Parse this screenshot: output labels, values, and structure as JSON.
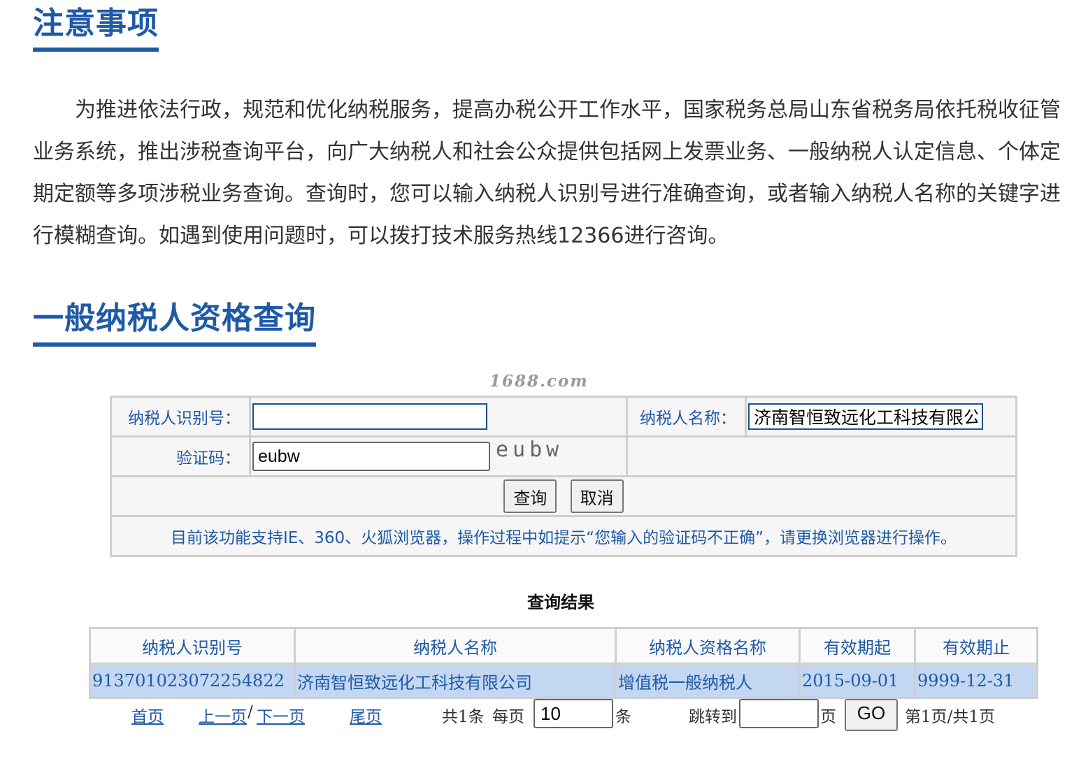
{
  "notice_section": {
    "title": "注意事项",
    "body": "为推进依法行政，规范和优化纳税服务，提高办税公开工作水平，国家税务总局山东省税务局依托税收征管业务系统，推出涉税查询平台，向广大纳税人和社会公众提供包括网上发票业务、一般纳税人认定信息、个体定期定额等多项涉税业务查询。查询时，您可以输入纳税人识别号进行准确查询，或者输入纳税人名称的关键字进行模糊查询。如遇到使用问题时，可以拨打技术服务热线12366进行咨询。"
  },
  "query_section": {
    "title": "一般纳税人资格查询",
    "watermark": "1688.com"
  },
  "form": {
    "taxid_label": "纳税人识别号：",
    "taxid_value": "",
    "taxname_label": "纳税人名称：",
    "taxname_value": "济南智恒致远化工科技有限公司",
    "captcha_label": "验证码：",
    "captcha_value": "eubw",
    "captcha_image_text": "eubw",
    "query_button": "查询",
    "cancel_button": "取消",
    "browser_notice": "目前该功能支持IE、360、火狐浏览器，操作过程中如提示“您输入的验证码不正确”，请更换浏览器进行操作。"
  },
  "results": {
    "title": "查询结果",
    "columns": [
      "纳税人识别号",
      "纳税人名称",
      "纳税人资格名称",
      "有效期起",
      "有效期止"
    ],
    "rows": [
      [
        "913701023072254822",
        "济南智恒致远化工科技有限公司",
        "增值税一般纳税人",
        "2015-09-01",
        "9999-12-31"
      ]
    ]
  },
  "pager": {
    "first": "首页",
    "prev": "上一页",
    "separator": "/",
    "next": "下一页",
    "last": "尾页",
    "total": "共1条",
    "per_page_label": "每页",
    "per_page_value": "10",
    "per_page_unit": "条",
    "jump_label": "跳转到",
    "jump_value": "",
    "page_unit": "页",
    "go_button": "GO",
    "page_info": "第1页/共1页"
  }
}
